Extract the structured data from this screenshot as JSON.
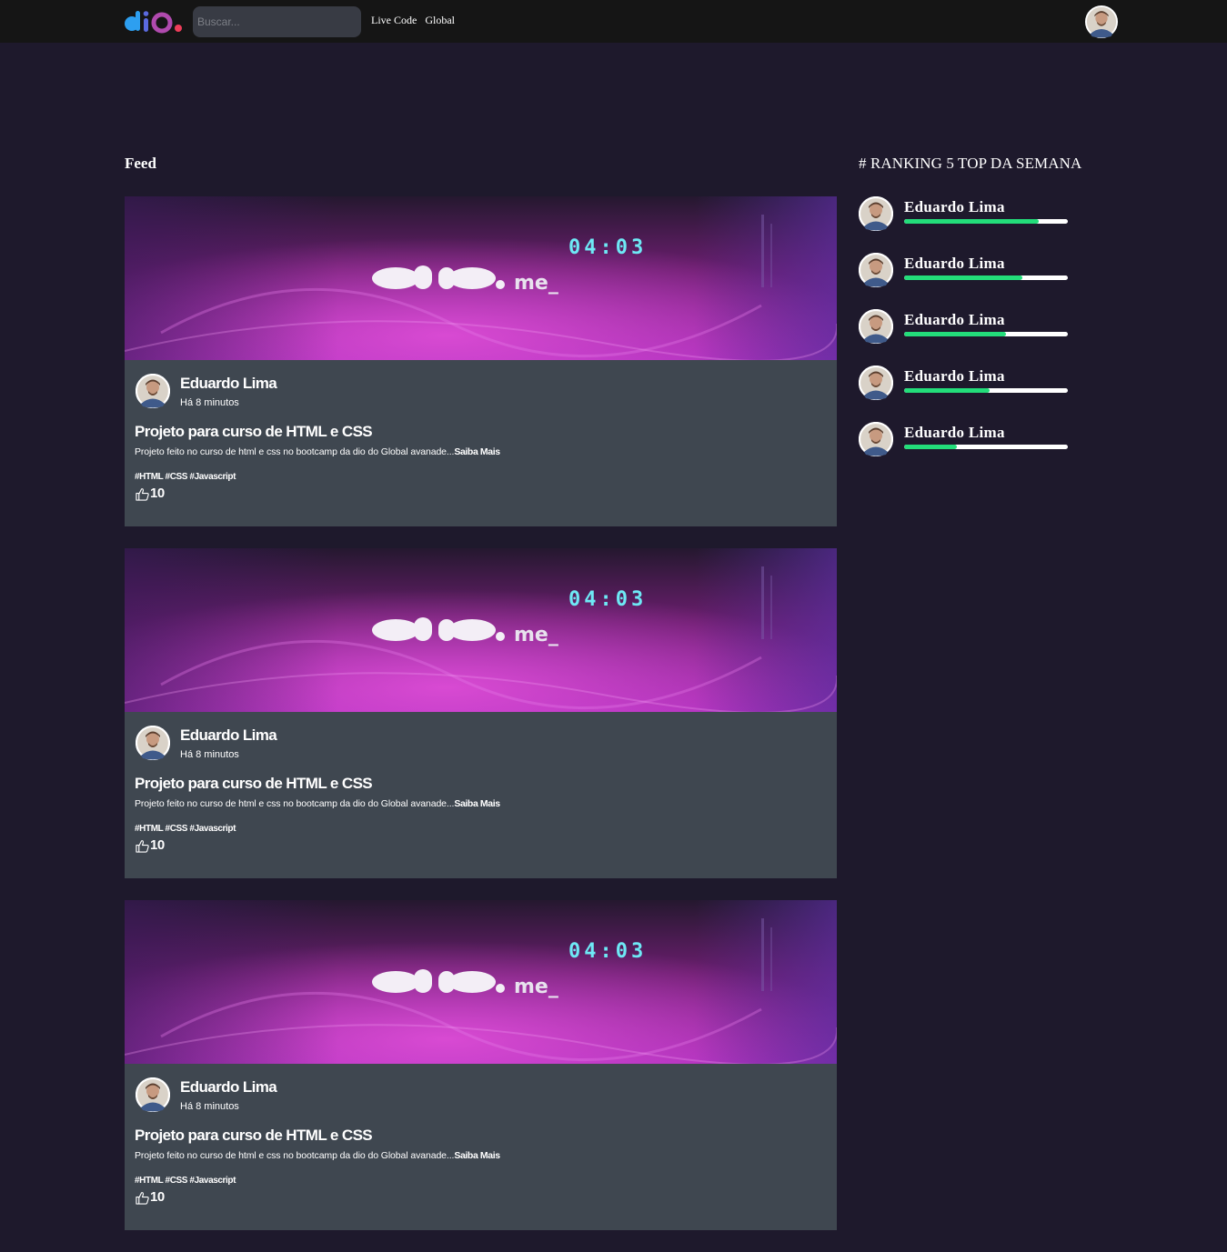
{
  "header": {
    "logo_alt": "dio",
    "search_placeholder": "Buscar...",
    "nav": [
      "Live Code",
      "Global"
    ]
  },
  "feed": {
    "title": "Feed",
    "posts": [
      {
        "banner": {
          "brand": "dio",
          "suffix": ".me_",
          "clock": "04:03"
        },
        "author": "Eduardo Lima",
        "time": "Há 8 minutos",
        "title": "Projeto para curso de HTML e CSS",
        "description": "Projeto feito no curso de html e css no bootcamp da dio do Global avanade...",
        "more_label": "Saiba Mais",
        "tags": "#HTML #CSS #Javascript",
        "likes": "10"
      },
      {
        "banner": {
          "brand": "dio",
          "suffix": ".me_",
          "clock": "04:03"
        },
        "author": "Eduardo Lima",
        "time": "Há 8 minutos",
        "title": "Projeto para curso de HTML e CSS",
        "description": "Projeto feito no curso de html e css no bootcamp da dio do Global avanade...",
        "more_label": "Saiba Mais",
        "tags": "#HTML #CSS #Javascript",
        "likes": "10"
      },
      {
        "banner": {
          "brand": "dio",
          "suffix": ".me_",
          "clock": "04:03"
        },
        "author": "Eduardo Lima",
        "time": "Há 8 minutos",
        "title": "Projeto para curso de HTML e CSS",
        "description": "Projeto feito no curso de html e css no bootcamp da dio do Global avanade...",
        "more_label": "Saiba Mais",
        "tags": "#HTML #CSS #Javascript",
        "likes": "10"
      }
    ]
  },
  "ranking": {
    "title": "# RANKING 5 TOP DA SEMANA",
    "items": [
      {
        "name": "Eduardo Lima",
        "progress": 0.82
      },
      {
        "name": "Eduardo Lima",
        "progress": 0.72
      },
      {
        "name": "Eduardo Lima",
        "progress": 0.62
      },
      {
        "name": "Eduardo Lima",
        "progress": 0.52
      },
      {
        "name": "Eduardo Lima",
        "progress": 0.32
      }
    ]
  },
  "colors": {
    "background": "#1e192c",
    "header": "#151515",
    "card": "#3f4750",
    "progress": "#23dd7a",
    "banner_accent": "#c23bd3",
    "clock": "#34e3f0"
  }
}
